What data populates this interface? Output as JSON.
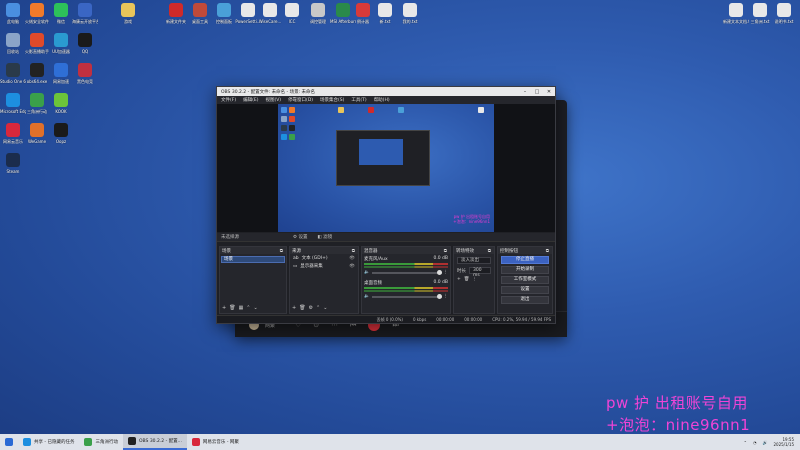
{
  "desktop": {
    "icons": [
      {
        "label": "此电脑",
        "color": "#4a8fe0"
      },
      {
        "label": "火绒安全软件",
        "color": "#f07a2a"
      },
      {
        "label": "微信",
        "color": "#2dc15a"
      },
      {
        "label": "海康云开放平台",
        "color": "#3a66c4"
      },
      {
        "label": "回收站",
        "color": "#8aa4c8"
      },
      {
        "label": "火影直播助手",
        "color": "#e04a2a"
      },
      {
        "label": "UU加速器",
        "color": "#2a9ad0"
      },
      {
        "label": "QQ",
        "color": "#1a1a1a"
      },
      {
        "label": "Studio One 6",
        "color": "#2a3a4a"
      },
      {
        "label": "obs64.exe",
        "color": "#222"
      },
      {
        "label": "网易加速",
        "color": "#2f6fd6"
      },
      {
        "label": "黑色电竞",
        "color": "#c03040"
      },
      {
        "label": "Microsoft Edge",
        "color": "#1d8fe0"
      },
      {
        "label": "三角洲行动",
        "color": "#3aa04a"
      },
      {
        "label": "KOOK",
        "color": "#6cc43a"
      },
      {
        "label": "网易云音乐",
        "color": "#d8283c"
      },
      {
        "label": "WeGame",
        "color": "#e0702a"
      },
      {
        "label": "Oopz",
        "color": "#1a1a1a"
      },
      {
        "label": "Steam",
        "color": "#1b2c4c"
      },
      {
        "label": "游戏",
        "color": "#e8c45a"
      },
      {
        "label": "新建文件夹",
        "color": "#d02a2a"
      },
      {
        "label": "桌面工具",
        "color": "#c04a3a"
      },
      {
        "label": "控制面板",
        "color": "#4aa0d8"
      },
      {
        "label": "PowerSetti...",
        "color": "#e8e8e8"
      },
      {
        "label": "WiseCare...",
        "color": "#e8e8e8"
      },
      {
        "label": "ICC",
        "color": "#e8e8e8"
      },
      {
        "label": "调控管理",
        "color": "#c8c8c8"
      },
      {
        "label": "MSI Afterburner",
        "color": "#2a8a4a"
      },
      {
        "label": "倒计器",
        "color": "#d83a3a"
      },
      {
        "label": "新.txt",
        "color": "#e8e8e8"
      },
      {
        "label": "我的.txt",
        "color": "#e8e8e8"
      },
      {
        "label": "新建文本文档.txt",
        "color": "#e8e8e8"
      },
      {
        "label": "三角洲.txt",
        "color": "#e8e8e8"
      },
      {
        "label": "说明书.txt",
        "color": "#e8e8e8"
      }
    ],
    "watermark_line1": "pw 护 出租账号自用",
    "watermark_line2": "+泡泡：nine96nn1"
  },
  "media_player": {
    "user_name": "网聚",
    "time": "00:00:00",
    "accent": "#e0323d"
  },
  "obs": {
    "title": "OBS 30.2.2 - 配置文件: 未命名 - 场景: 未命名",
    "menu": [
      "文件(F)",
      "编辑(E)",
      "视图(V)",
      "停靠窗口(D)",
      "场景集合(S)",
      "工具(T)",
      "帮助(H)"
    ],
    "scene_bar": {
      "label": "未选择源",
      "tab1": "⚙ 设置",
      "tab2": "◧ 滤镜"
    },
    "preview_watermark": [
      "pw 护 出租账号自用",
      "+泡泡：nine96nn1"
    ],
    "scenes": {
      "header": "场景",
      "items": [
        "场景"
      ]
    },
    "sources": {
      "header": "来源",
      "items": [
        "文本 (GDI+)",
        "显示器采集"
      ]
    },
    "mixer": {
      "header": "混音器",
      "channels": [
        {
          "name": "麦克风/Aux",
          "db": "0.0 dB"
        },
        {
          "name": "桌面音频",
          "db": "0.0 dB"
        }
      ]
    },
    "transitions": {
      "header": "转场特效",
      "type": "淡入淡出",
      "duration_label": "时长",
      "duration": "300 ms"
    },
    "controls": {
      "header": "控制按钮",
      "buttons": [
        "停止直播",
        "开始录制",
        "工作室模式",
        "设置",
        "退出"
      ]
    },
    "status": {
      "dropped": "丢帧 0 (0.0%)",
      "bitrate": "0 kbps",
      "live_time": "00:00:00",
      "rec_time": "00:00:00",
      "cpu": "CPU: 0.2%, 59.94 / 59.94 FPS"
    }
  },
  "taskbar": {
    "items": [
      {
        "label": "开始",
        "color": "#2a6ad4"
      },
      {
        "label": "共享 - 已隐藏的任务",
        "color": "#1d8fe0"
      },
      {
        "label": "三角洲行动",
        "color": "#3aa04a"
      },
      {
        "label": "OBS 30.2.2 - 配置...",
        "color": "#222",
        "active": true
      },
      {
        "label": "网易云音乐 - 网聚",
        "color": "#d8283c"
      }
    ],
    "time": "19:55",
    "date": "2025/1/15"
  }
}
